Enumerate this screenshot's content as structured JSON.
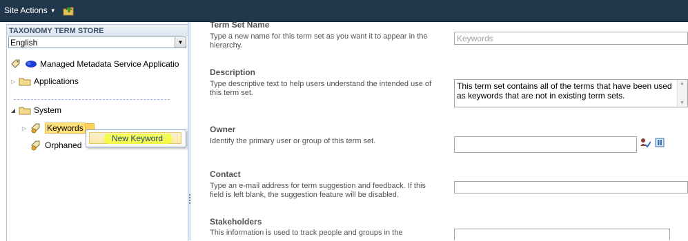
{
  "topbar": {
    "site_actions": "Site Actions"
  },
  "tree": {
    "title": "TAXONOMY TERM STORE",
    "language": "English",
    "root": "Managed Metadata Service Applicatio",
    "applications": "Applications",
    "system": "System",
    "keywords": "Keywords",
    "orphaned": "Orphaned"
  },
  "context_menu": {
    "new_keyword": "New Keyword"
  },
  "form": {
    "term_set_name": {
      "title": "Term Set Name",
      "desc": "Type a new name for this term set as you want it to appear in the hierarchy.",
      "value": "Keywords"
    },
    "description": {
      "title": "Description",
      "desc": "Type descriptive text to help users understand the intended use of this term set.",
      "value": "This term set contains all of the terms that have been used as keywords that are not in existing term sets."
    },
    "owner": {
      "title": "Owner",
      "desc": "Identify the primary user or group of this term set.",
      "value": ""
    },
    "contact": {
      "title": "Contact",
      "desc": "Type an e-mail address for term suggestion and feedback. If this field is left blank, the suggestion feature will be disabled.",
      "value": ""
    },
    "stakeholders": {
      "title": "Stakeholders",
      "desc": "This information is used to track people and groups in the"
    }
  },
  "colors": {
    "topbar": "#21374c",
    "highlight": "#ffe27a",
    "marker": "#f2ff2f"
  }
}
